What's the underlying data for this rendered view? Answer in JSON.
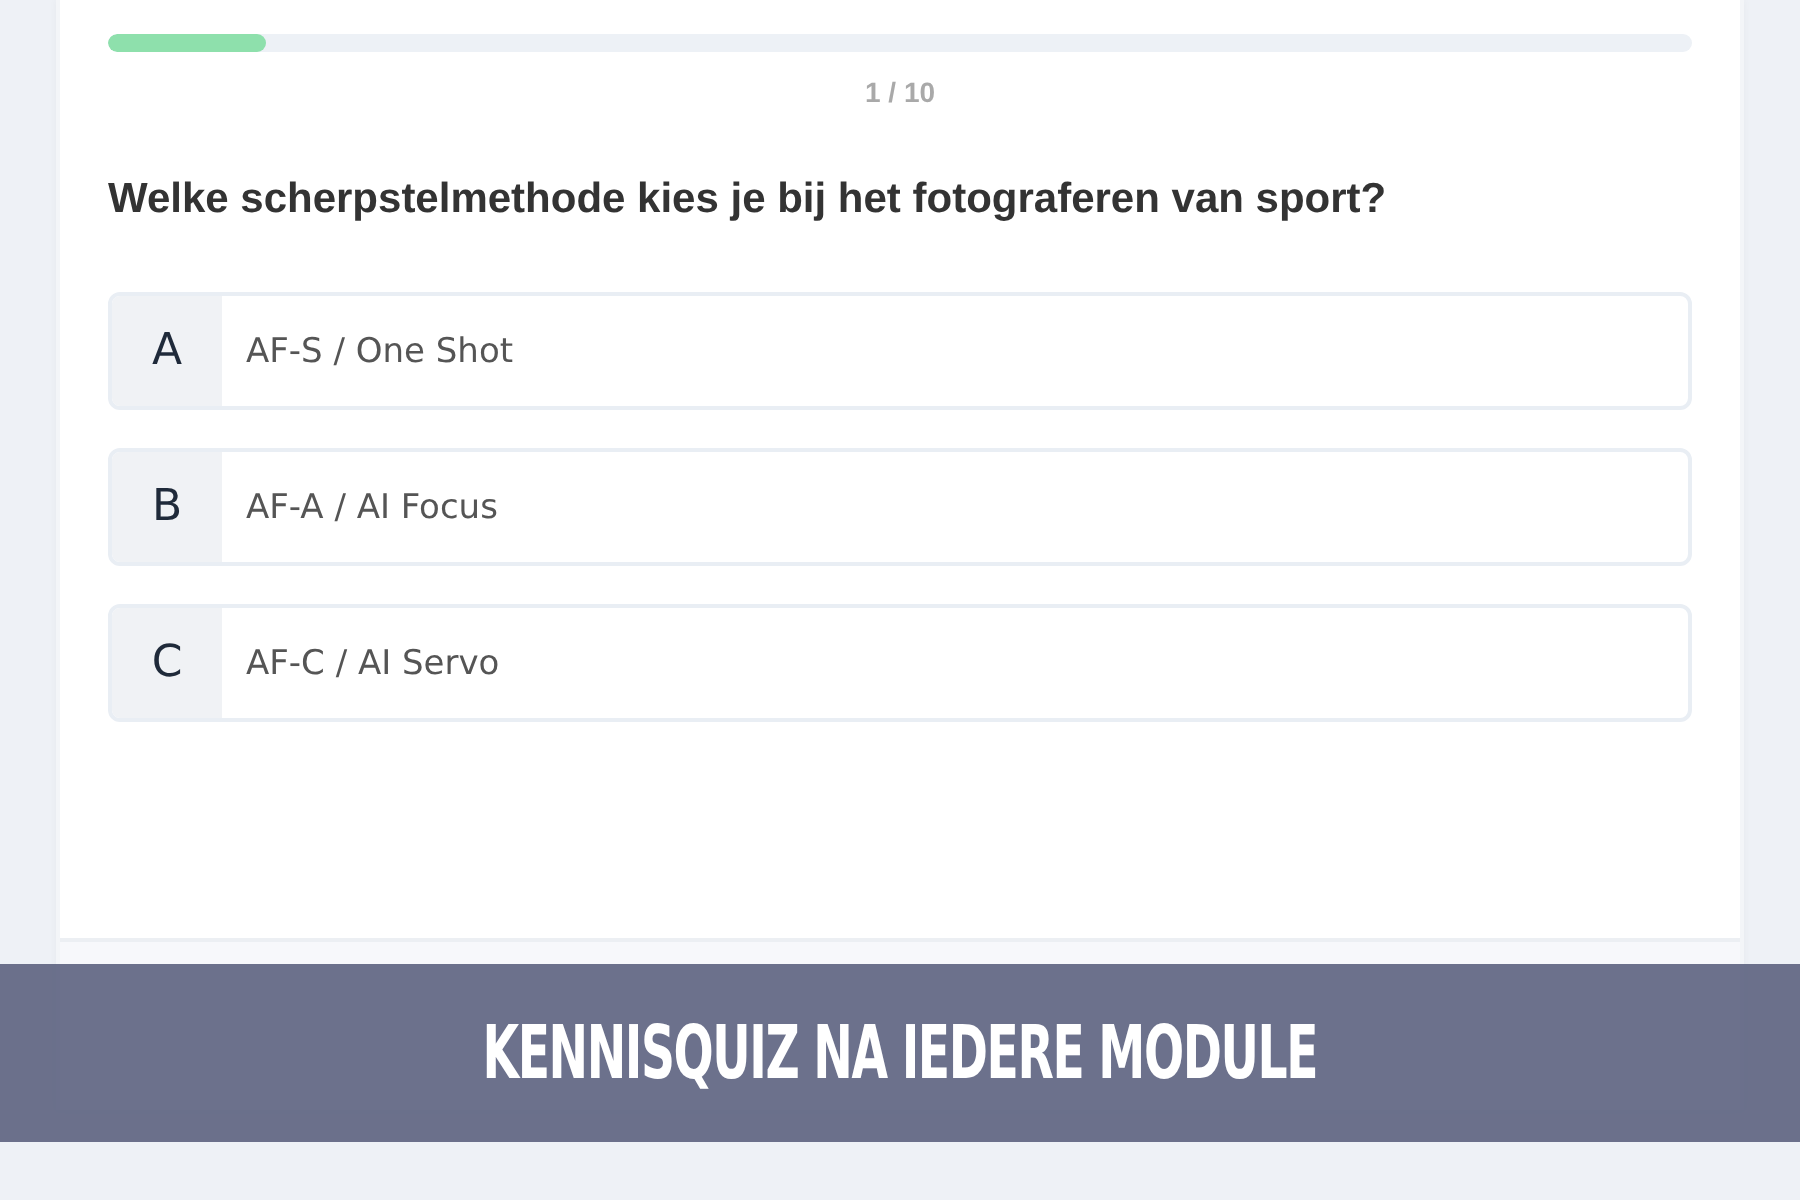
{
  "progress": {
    "level": 0.1,
    "counter": "1 / 10"
  },
  "question": "Welke scherpstelmethode kies je bij het fotograferen van sport?",
  "options": [
    {
      "letter": "A",
      "text": "AF-S / One Shot",
      "selected": false
    },
    {
      "letter": "B",
      "text": "AF-A / AI Focus",
      "selected": false
    },
    {
      "letter": "C",
      "text": "AF-C / AI Servo",
      "selected": false
    }
  ],
  "banner": {
    "text": "KENNISQUIZ NA IEDERE MODULE"
  }
}
